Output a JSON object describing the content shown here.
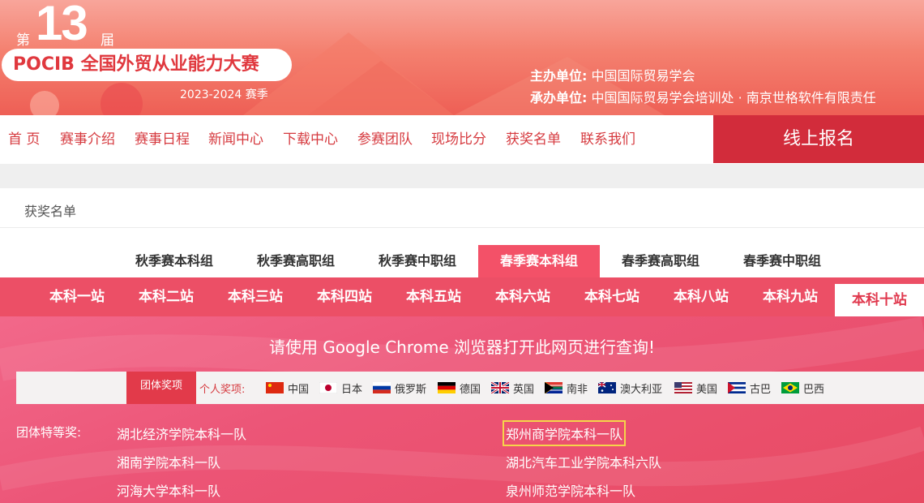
{
  "banner": {
    "edition_pre": "第",
    "edition_num": "13",
    "edition_post": "届",
    "title": "POCIB 全国外贸从业能力大赛",
    "season": "2023-2024 赛季",
    "host_label": "主办单位:",
    "host_value": "中国国际贸易学会",
    "organizer_label": "承办单位:",
    "organizer_value": "中国国际贸易学会培训处 · 南京世格软件有限责任"
  },
  "nav": {
    "items": [
      "首 页",
      "赛事介绍",
      "赛事日程",
      "新闻中心",
      "下载中心",
      "参赛团队",
      "现场比分",
      "获奖名单",
      "联系我们"
    ],
    "signup": "线上报名"
  },
  "breadcrumb": "获奖名单",
  "group_tabs": {
    "items": [
      "秋季赛本科组",
      "秋季赛高职组",
      "秋季赛中职组",
      "春季赛本科组",
      "春季赛高职组",
      "春季赛中职组"
    ],
    "active": "春季赛本科组"
  },
  "stations": {
    "items": [
      "本科一站",
      "本科二站",
      "本科三站",
      "本科四站",
      "本科五站",
      "本科六站",
      "本科七站",
      "本科八站",
      "本科九站",
      "本科十站"
    ],
    "active": "本科十站"
  },
  "notice": "请使用 Google Chrome 浏览器打开此网页进行查询!",
  "filter": {
    "team_award": "团体奖项",
    "personal_label": "个人奖项:",
    "countries": [
      "中国",
      "日本",
      "俄罗斯",
      "德国",
      "英国",
      "南非",
      "澳大利亚",
      "美国",
      "古巴",
      "巴西"
    ]
  },
  "awards": {
    "label": "团体特等奖:",
    "left": [
      "湖北经济学院本科一队",
      "湘南学院本科一队",
      "河海大学本科一队"
    ],
    "right": [
      "郑州商学院本科一队",
      "湖北汽车工业学院本科六队",
      "泉州师范学院本科一队"
    ]
  },
  "colors": {
    "brand_red": "#d22c3b",
    "nav_text": "#d63a3f",
    "tab_active": "#f35168",
    "station_bar": "#ec4f66",
    "highlight_border": "#f5d54a"
  }
}
